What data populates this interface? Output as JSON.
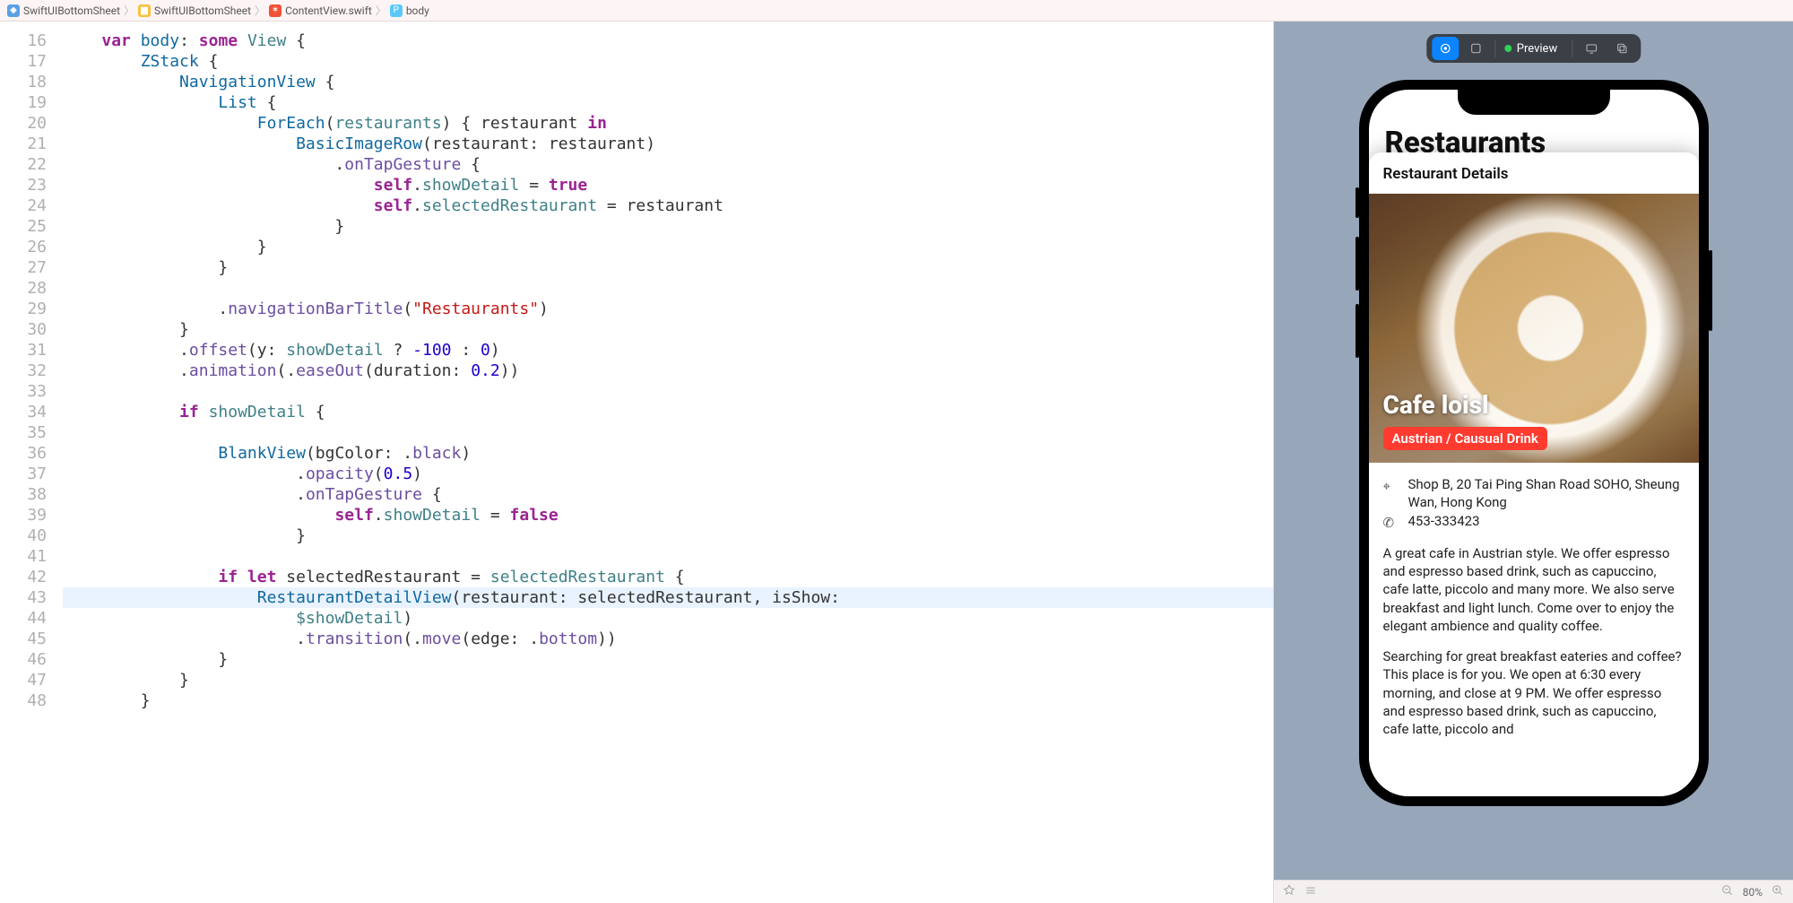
{
  "breadcrumb": {
    "project": "SwiftUIBottomSheet",
    "folder": "SwiftUIBottomSheet",
    "file": "ContentView.swift",
    "symbol": "body"
  },
  "editor": {
    "first_line_number": 16,
    "highlighted_line_number": 43,
    "lines": [
      [
        [
          "    ",
          ""
        ],
        [
          "var",
          "kw"
        ],
        [
          " ",
          ""
        ],
        [
          "body",
          "decl"
        ],
        [
          ": ",
          ""
        ],
        [
          "some",
          "kw"
        ],
        [
          " ",
          ""
        ],
        [
          "View",
          "type"
        ],
        [
          " {",
          ""
        ]
      ],
      [
        [
          "        ",
          ""
        ],
        [
          "ZStack",
          "decl"
        ],
        [
          " {",
          ""
        ]
      ],
      [
        [
          "            ",
          ""
        ],
        [
          "NavigationView",
          "decl"
        ],
        [
          " {",
          ""
        ]
      ],
      [
        [
          "                ",
          ""
        ],
        [
          "List",
          "decl"
        ],
        [
          " {",
          ""
        ]
      ],
      [
        [
          "                    ",
          ""
        ],
        [
          "ForEach",
          "decl"
        ],
        [
          "(",
          ""
        ],
        [
          "restaurants",
          "type"
        ],
        [
          ") { restaurant ",
          ""
        ],
        [
          "in",
          "kw"
        ]
      ],
      [
        [
          "                        ",
          ""
        ],
        [
          "BasicImageRow",
          "decl"
        ],
        [
          "(restaurant: restaurant)",
          ""
        ]
      ],
      [
        [
          "                            .",
          ""
        ],
        [
          "onTapGesture",
          "call"
        ],
        [
          " {",
          ""
        ]
      ],
      [
        [
          "                                ",
          ""
        ],
        [
          "self",
          "kw"
        ],
        [
          ".",
          ""
        ],
        [
          "showDetail",
          "type"
        ],
        [
          " = ",
          ""
        ],
        [
          "true",
          "kw"
        ]
      ],
      [
        [
          "                                ",
          ""
        ],
        [
          "self",
          "kw"
        ],
        [
          ".",
          ""
        ],
        [
          "selectedRestaurant",
          "type"
        ],
        [
          " = restaurant",
          ""
        ]
      ],
      [
        [
          "                            }",
          ""
        ]
      ],
      [
        [
          "                    }",
          ""
        ]
      ],
      [
        [
          "                }",
          ""
        ]
      ],
      [
        [
          "",
          ""
        ]
      ],
      [
        [
          "                .",
          ""
        ],
        [
          "navigationBarTitle",
          "call"
        ],
        [
          "(",
          ""
        ],
        [
          "\"Restaurants\"",
          "str"
        ],
        [
          ")",
          ""
        ]
      ],
      [
        [
          "            }",
          ""
        ]
      ],
      [
        [
          "            .",
          ""
        ],
        [
          "offset",
          "call"
        ],
        [
          "(y: ",
          ""
        ],
        [
          "showDetail",
          "type"
        ],
        [
          " ? ",
          ""
        ],
        [
          "-100",
          "num"
        ],
        [
          " : ",
          ""
        ],
        [
          "0",
          "num"
        ],
        [
          ")",
          ""
        ]
      ],
      [
        [
          "            .",
          ""
        ],
        [
          "animation",
          "call"
        ],
        [
          "(.",
          ""
        ],
        [
          "easeOut",
          "call"
        ],
        [
          "(duration: ",
          ""
        ],
        [
          "0.2",
          "num"
        ],
        [
          "))",
          ""
        ]
      ],
      [
        [
          "",
          ""
        ]
      ],
      [
        [
          "            ",
          ""
        ],
        [
          "if",
          "kw"
        ],
        [
          " ",
          ""
        ],
        [
          "showDetail",
          "type"
        ],
        [
          " {",
          ""
        ]
      ],
      [
        [
          "",
          ""
        ]
      ],
      [
        [
          "                ",
          ""
        ],
        [
          "BlankView",
          "decl"
        ],
        [
          "(bgColor: .",
          ""
        ],
        [
          "black",
          "call"
        ],
        [
          ")",
          ""
        ]
      ],
      [
        [
          "                        .",
          ""
        ],
        [
          "opacity",
          "call"
        ],
        [
          "(",
          ""
        ],
        [
          "0.5",
          "num"
        ],
        [
          ")",
          ""
        ]
      ],
      [
        [
          "                        .",
          ""
        ],
        [
          "onTapGesture",
          "call"
        ],
        [
          " {",
          ""
        ]
      ],
      [
        [
          "                            ",
          ""
        ],
        [
          "self",
          "kw"
        ],
        [
          ".",
          ""
        ],
        [
          "showDetail",
          "type"
        ],
        [
          " = ",
          ""
        ],
        [
          "false",
          "kw"
        ]
      ],
      [
        [
          "                        }",
          ""
        ]
      ],
      [
        [
          "",
          ""
        ]
      ],
      [
        [
          "                ",
          ""
        ],
        [
          "if",
          "kw"
        ],
        [
          " ",
          ""
        ],
        [
          "let",
          "kw"
        ],
        [
          " selectedRestaurant = ",
          ""
        ],
        [
          "selectedRestaurant",
          "type"
        ],
        [
          " {",
          ""
        ]
      ],
      [
        [
          "                    ",
          ""
        ],
        [
          "RestaurantDetailView",
          "decl"
        ],
        [
          "(restaurant: selectedRestaurant, isShow:",
          ""
        ]
      ],
      [
        [
          "                        ",
          ""
        ],
        [
          "$showDetail",
          "type"
        ],
        [
          ")",
          ""
        ]
      ],
      [
        [
          "                        .",
          ""
        ],
        [
          "transition",
          "call"
        ],
        [
          "(.",
          ""
        ],
        [
          "move",
          "call"
        ],
        [
          "(edge: .",
          ""
        ],
        [
          "bottom",
          "call"
        ],
        [
          "))",
          ""
        ]
      ],
      [
        [
          "                }",
          ""
        ]
      ],
      [
        [
          "            }",
          ""
        ]
      ],
      [
        [
          "        }",
          ""
        ]
      ]
    ]
  },
  "canvas": {
    "toolbar": {
      "preview_label": "Preview"
    },
    "status": {
      "zoom": "80%"
    }
  },
  "preview": {
    "nav_title": "Restaurants",
    "sheet": {
      "header": "Restaurant Details",
      "name": "Cafe loisl",
      "tag": "Austrian / Causual Drink",
      "address": "Shop B, 20 Tai Ping Shan Road SOHO, Sheung Wan, Hong Kong",
      "phone": "453-333423",
      "desc1": "A great cafe in Austrian style. We offer espresso and espresso based drink, such as capuccino, cafe latte, piccolo and many more. We also serve breakfast and light lunch. Come over to enjoy the elegant ambience and quality coffee.",
      "desc2": "Searching for great breakfast eateries and coffee? This place is for you. We open at 6:30 every morning, and close at 9 PM. We offer espresso and espresso based drink, such as capuccino, cafe latte, piccolo and"
    }
  }
}
